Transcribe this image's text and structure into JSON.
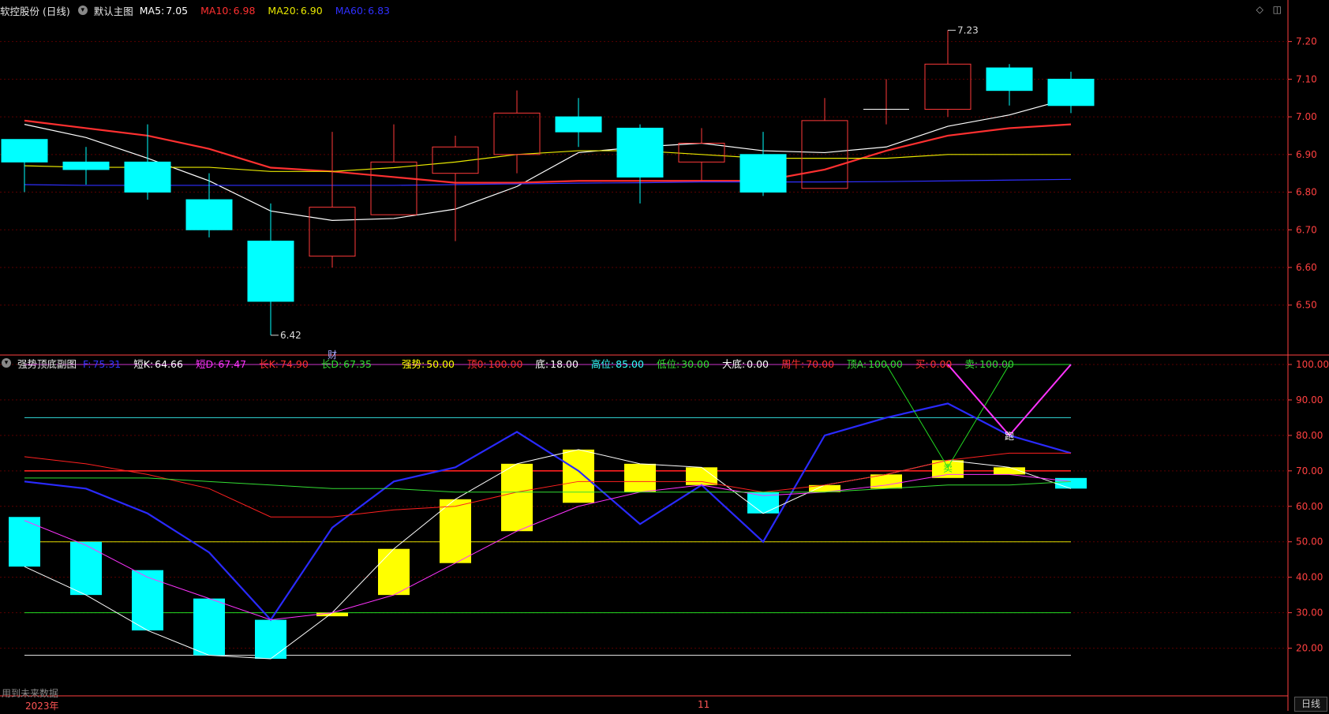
{
  "header": {
    "title": "软控股份 (日线)",
    "chart_name": "默认主图",
    "ma": [
      {
        "label": "MA5:",
        "value": "7.05",
        "color": "#ffffff"
      },
      {
        "label": "MA10:",
        "value": "6.98",
        "color": "#ff3030"
      },
      {
        "label": "MA20:",
        "value": "6.90",
        "color": "#e8e800"
      },
      {
        "label": "MA60:",
        "value": "6.83",
        "color": "#2f2fff"
      }
    ]
  },
  "sub_header": {
    "name": "强势顶底副图",
    "items": [
      {
        "label": "F:",
        "value": "75.31",
        "color": "#3333ff"
      },
      {
        "label": "短K:",
        "value": "64.66",
        "color": "#ffffff"
      },
      {
        "label": "短D:",
        "value": "67.47",
        "color": "#ff33ff"
      },
      {
        "label": "长K:",
        "value": "74.90",
        "color": "#ff3030"
      },
      {
        "label": "长D:",
        "value": "67.35",
        "color": "#33dd33"
      },
      {
        "label": "强势:",
        "value": "50.00",
        "color": "#ffff00"
      },
      {
        "label": "顶0:",
        "value": "100.00",
        "color": "#ff3030"
      },
      {
        "label": "底:",
        "value": "18.00",
        "color": "#ffffff"
      },
      {
        "label": "高位:",
        "value": "85.00",
        "color": "#33ffff"
      },
      {
        "label": "低位:",
        "value": "30.00",
        "color": "#33dd33"
      },
      {
        "label": "大底:",
        "value": "0.00",
        "color": "#ffffff"
      },
      {
        "label": "周牛:",
        "value": "70.00",
        "color": "#ff3030"
      },
      {
        "label": "顶A:",
        "value": "100.00",
        "color": "#33dd33"
      },
      {
        "label": "买:",
        "value": "0.00",
        "color": "#ff3030"
      },
      {
        "label": "卖:",
        "value": "100.00",
        "color": "#33dd33"
      }
    ]
  },
  "window_icons": [
    "diamond-icon",
    "panel-icon"
  ],
  "footnote": "用到未来数据",
  "axis_dates": {
    "left": "2023年",
    "mid": "11"
  },
  "period_button": "日线",
  "colors": {
    "up": "#ff3a3a",
    "down": "#00ffff",
    "grid": "#5a0000",
    "axis": "#ff4040"
  },
  "chart_data": [
    {
      "type": "candlestick",
      "title": "",
      "ylim": [
        6.38,
        7.26
      ],
      "yticks": [
        6.5,
        6.6,
        6.7,
        6.8,
        6.9,
        7.0,
        7.1,
        7.2
      ],
      "ytick_labels": [
        "6.50",
        "6.60",
        "6.70",
        "6.80",
        "6.90",
        "7.00",
        "7.10",
        "7.20"
      ],
      "candles": [
        {
          "o": 6.94,
          "h": 6.94,
          "l": 6.8,
          "c": 6.88
        },
        {
          "o": 6.88,
          "h": 6.92,
          "l": 6.82,
          "c": 6.86
        },
        {
          "o": 6.88,
          "h": 6.98,
          "l": 6.78,
          "c": 6.8
        },
        {
          "o": 6.78,
          "h": 6.85,
          "l": 6.68,
          "c": 6.7
        },
        {
          "o": 6.67,
          "h": 6.77,
          "l": 6.42,
          "c": 6.51
        },
        {
          "o": 6.63,
          "h": 6.96,
          "l": 6.6,
          "c": 6.76
        },
        {
          "o": 6.74,
          "h": 6.98,
          "l": 6.74,
          "c": 6.88
        },
        {
          "o": 6.85,
          "h": 6.95,
          "l": 6.67,
          "c": 6.92
        },
        {
          "o": 6.9,
          "h": 7.07,
          "l": 6.85,
          "c": 7.01
        },
        {
          "o": 7.0,
          "h": 7.05,
          "l": 6.92,
          "c": 6.96
        },
        {
          "o": 6.97,
          "h": 6.98,
          "l": 6.77,
          "c": 6.84
        },
        {
          "o": 6.88,
          "h": 6.97,
          "l": 6.83,
          "c": 6.93
        },
        {
          "o": 6.9,
          "h": 6.96,
          "l": 6.79,
          "c": 6.8
        },
        {
          "o": 6.81,
          "h": 7.05,
          "l": 6.81,
          "c": 6.99
        },
        {
          "o": 7.02,
          "h": 7.1,
          "l": 6.98,
          "c": 7.02
        },
        {
          "o": 7.02,
          "h": 7.23,
          "l": 7.0,
          "c": 7.14
        },
        {
          "o": 7.13,
          "h": 7.14,
          "l": 7.03,
          "c": 7.07
        },
        {
          "o": 7.1,
          "h": 7.12,
          "l": 7.01,
          "c": 7.03
        }
      ],
      "ma_series": [
        {
          "name": "MA5",
          "color": "#ffffff",
          "values": [
            6.98,
            6.945,
            6.89,
            6.83,
            6.75,
            6.725,
            6.73,
            6.755,
            6.815,
            6.905,
            6.92,
            6.93,
            6.91,
            6.905,
            6.92,
            6.975,
            7.005,
            7.05
          ]
        },
        {
          "name": "MA10",
          "color": "#ff3030",
          "values": [
            6.99,
            6.97,
            6.95,
            6.915,
            6.865,
            6.855,
            6.84,
            6.825,
            6.825,
            6.83,
            6.83,
            6.83,
            6.83,
            6.86,
            6.91,
            6.95,
            6.97,
            6.98
          ]
        },
        {
          "name": "MA20",
          "color": "#e8e800",
          "values": [
            6.87,
            6.866,
            6.866,
            6.866,
            6.855,
            6.855,
            6.865,
            6.88,
            6.9,
            6.91,
            6.91,
            6.9,
            6.89,
            6.89,
            6.89,
            6.9,
            6.9,
            6.9
          ]
        },
        {
          "name": "MA60",
          "color": "#2f2fff",
          "values": [
            6.82,
            6.818,
            6.818,
            6.818,
            6.818,
            6.818,
            6.818,
            6.82,
            6.822,
            6.824,
            6.825,
            6.827,
            6.827,
            6.827,
            6.828,
            6.83,
            6.832,
            6.834
          ]
        }
      ],
      "annotations": [
        {
          "text": "7.23",
          "index": 15,
          "value": 7.23
        },
        {
          "text": "6.42",
          "index": 4,
          "value": 6.42
        },
        {
          "text": "财",
          "index": 5,
          "value": 6.38
        }
      ]
    },
    {
      "type": "indicator",
      "title": "",
      "ylim": [
        7,
        102
      ],
      "yticks": [
        20,
        30,
        40,
        50,
        60,
        70,
        80,
        90,
        100
      ],
      "ytick_labels": [
        "20.00",
        "30.00",
        "40.00",
        "50.00",
        "60.00",
        "70.00",
        "80.00",
        "90.00",
        "100.00"
      ],
      "hlines": [
        {
          "value": 100,
          "color": "#cc33cc"
        },
        {
          "value": 85,
          "color": "#33dddd"
        },
        {
          "value": 70,
          "color": "#ff2020"
        },
        {
          "value": 50,
          "color": "#dddd00"
        },
        {
          "value": 30,
          "color": "#22dd22"
        },
        {
          "value": 18,
          "color": "#dddddd"
        },
        {
          "value": 0,
          "color": "#ff2020"
        }
      ],
      "bars": [
        {
          "top": 57,
          "bottom": 43,
          "color": "#00ffff"
        },
        {
          "top": 50,
          "bottom": 35,
          "color": "#00ffff"
        },
        {
          "top": 42,
          "bottom": 25,
          "color": "#00ffff"
        },
        {
          "top": 34,
          "bottom": 18,
          "color": "#00ffff"
        },
        {
          "top": 28,
          "bottom": 17,
          "color": "#00ffff"
        },
        {
          "top": 30,
          "bottom": 29,
          "color": "#ffff00"
        },
        {
          "top": 48,
          "bottom": 35,
          "color": "#ffff00"
        },
        {
          "top": 62,
          "bottom": 44,
          "color": "#ffff00"
        },
        {
          "top": 72,
          "bottom": 53,
          "color": "#ffff00"
        },
        {
          "top": 76,
          "bottom": 61,
          "color": "#ffff00"
        },
        {
          "top": 72,
          "bottom": 64,
          "color": "#ffff00"
        },
        {
          "top": 71,
          "bottom": 66,
          "color": "#ffff00"
        },
        {
          "top": 64,
          "bottom": 58,
          "color": "#00ffff"
        },
        {
          "top": 66,
          "bottom": 64,
          "color": "#ffff00"
        },
        {
          "top": 69,
          "bottom": 65,
          "color": "#ffff00"
        },
        {
          "top": 73,
          "bottom": 68,
          "color": "#ffff00"
        },
        {
          "top": 71,
          "bottom": 69,
          "color": "#ffff00"
        },
        {
          "top": 68,
          "bottom": 65,
          "color": "#00ffff"
        }
      ],
      "series": [
        {
          "name": "F",
          "color": "#2a2aff",
          "width": 2.2,
          "values": [
            67,
            65,
            58,
            47,
            28,
            54,
            67,
            71,
            81,
            70,
            55,
            66,
            50,
            80,
            85,
            89,
            80,
            75
          ]
        },
        {
          "name": "短K",
          "color": "#ffffff",
          "width": 1,
          "values": [
            43,
            35,
            25,
            18,
            17,
            30,
            48,
            62,
            72,
            76,
            72,
            71,
            58,
            66,
            69,
            73,
            71,
            65
          ]
        },
        {
          "name": "短D",
          "color": "#ff33ff",
          "width": 1,
          "values": [
            56,
            49,
            40,
            34,
            28,
            30,
            35,
            44,
            53,
            60,
            64,
            66,
            63,
            64,
            66,
            69,
            69,
            67
          ]
        },
        {
          "name": "长K",
          "color": "#ff2020",
          "width": 1,
          "values": [
            74,
            72,
            69,
            65,
            57,
            57,
            59,
            60,
            64,
            67,
            67,
            67,
            64,
            66,
            69,
            73,
            75,
            75
          ]
        },
        {
          "name": "长D",
          "color": "#33dd33",
          "width": 1,
          "values": [
            68,
            68,
            68,
            67,
            66,
            65,
            65,
            64,
            64,
            64,
            64,
            64,
            64,
            64,
            65,
            66,
            66,
            67
          ]
        }
      ],
      "segments": [
        {
          "color": "#22dd22",
          "width": 1,
          "points": [
            [
              14,
              100
            ],
            [
              15,
              71
            ],
            [
              16,
              100
            ],
            [
              17,
              100
            ]
          ]
        },
        {
          "color": "#ff33ff",
          "width": 2,
          "points": [
            [
              15,
              100
            ],
            [
              16,
              80
            ],
            [
              17,
              100
            ]
          ]
        }
      ],
      "markers": [
        {
          "text": "卖",
          "index": 15,
          "value": 71,
          "color": "#22dd22"
        },
        {
          "text": "跑",
          "index": 16,
          "value": 80,
          "color": "#ffffff"
        }
      ]
    }
  ]
}
